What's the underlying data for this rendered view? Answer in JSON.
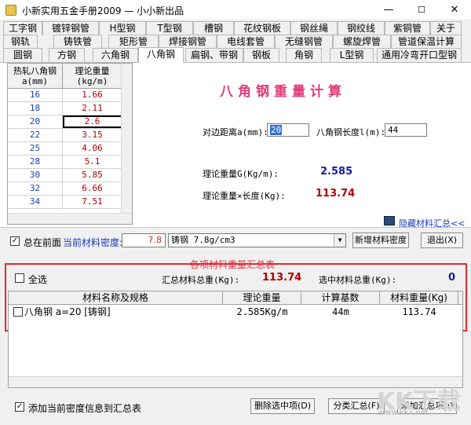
{
  "window": {
    "title": "小新实用五金手册2009 — 小小新出品",
    "minimize": "—",
    "maximize": "☐",
    "close": "✕"
  },
  "tabs": {
    "row1": [
      "工字钢",
      "镀锌钢管",
      "H型钢",
      "T型钢",
      "槽钢",
      "花纹钢板",
      "钢丝绳",
      "钢绞线",
      "紫铜管",
      "关于"
    ],
    "row2": [
      "钢轨",
      "铸铁管",
      "矩形管",
      "焊接钢管",
      "电线套管",
      "无缝钢管",
      "螺旋焊管",
      "管道保温计算"
    ],
    "row3": [
      "圆钢",
      "方钢",
      "六角钢",
      "八角钢",
      "扁钢、带钢",
      "钢板",
      "角钢",
      "L型钢",
      "通用冷弯开口型钢"
    ],
    "active": "八角钢"
  },
  "grid": {
    "headers": [
      "热轧八角钢\na(mm)",
      "理论重量\n(kg/m)"
    ],
    "rows": [
      [
        "16",
        "1.66"
      ],
      [
        "18",
        "2.11"
      ],
      [
        "20",
        "2.6"
      ],
      [
        "22",
        "3.15"
      ],
      [
        "25",
        "4.06"
      ],
      [
        "28",
        "5.1"
      ],
      [
        "30",
        "5.85"
      ],
      [
        "32",
        "6.66"
      ],
      [
        "34",
        "7.51"
      ]
    ],
    "selected_row": 2
  },
  "calc": {
    "title": "八角钢重量计算",
    "side_label": "对边距离a(mm):",
    "side_value": "20",
    "length_label": "八角钢长度l(m):",
    "length_value": "44",
    "weight_label": "理论重量G(Kg/m):",
    "weight_value": "2.585",
    "total_label": "理论重量×长度(Kg):",
    "total_value": "113.74",
    "hide_link": "隐藏材料汇总<<"
  },
  "controls": {
    "on_top_label": "总在前面",
    "on_top_checked": true,
    "density_label": "当前材料密度:",
    "density_value": "7.8",
    "material_select": "铸钢 7.8g/cm3",
    "new_density_button": "新增材料密度",
    "exit_button": "退出(X)"
  },
  "summary": {
    "title": "各项材料重量汇总表",
    "select_all_label": "全选",
    "total_label": "汇总材料总重(Kg):",
    "total_value": "113.74",
    "selected_total_label": "选中材料总重(Kg):",
    "selected_total_value": "0",
    "columns": [
      "材料名称及规格",
      "理论重量",
      "计算基数",
      "材料重量(Kg)"
    ],
    "rows": [
      {
        "name": "八角钢 a=20 [铸钢]",
        "weight": "2.585Kg/m",
        "base": "44m",
        "total": "113.74"
      }
    ]
  },
  "footer": {
    "add_density_label": "添加当前密度信息到汇总表",
    "add_density_checked": true,
    "delete_button": "删除选中项(D)",
    "classify_button": "分类汇总(F)",
    "add_button": "添加汇总项(I)"
  },
  "watermark": {
    "logo": "KK下载",
    "url": "www.kkx.net"
  },
  "colors": {
    "title_pink": "#e03c7a",
    "value_blue": "#1a1aa0",
    "value_red": "#b00000",
    "highlight_box": "#e02a2a",
    "link_blue": "#1a3ab8"
  }
}
